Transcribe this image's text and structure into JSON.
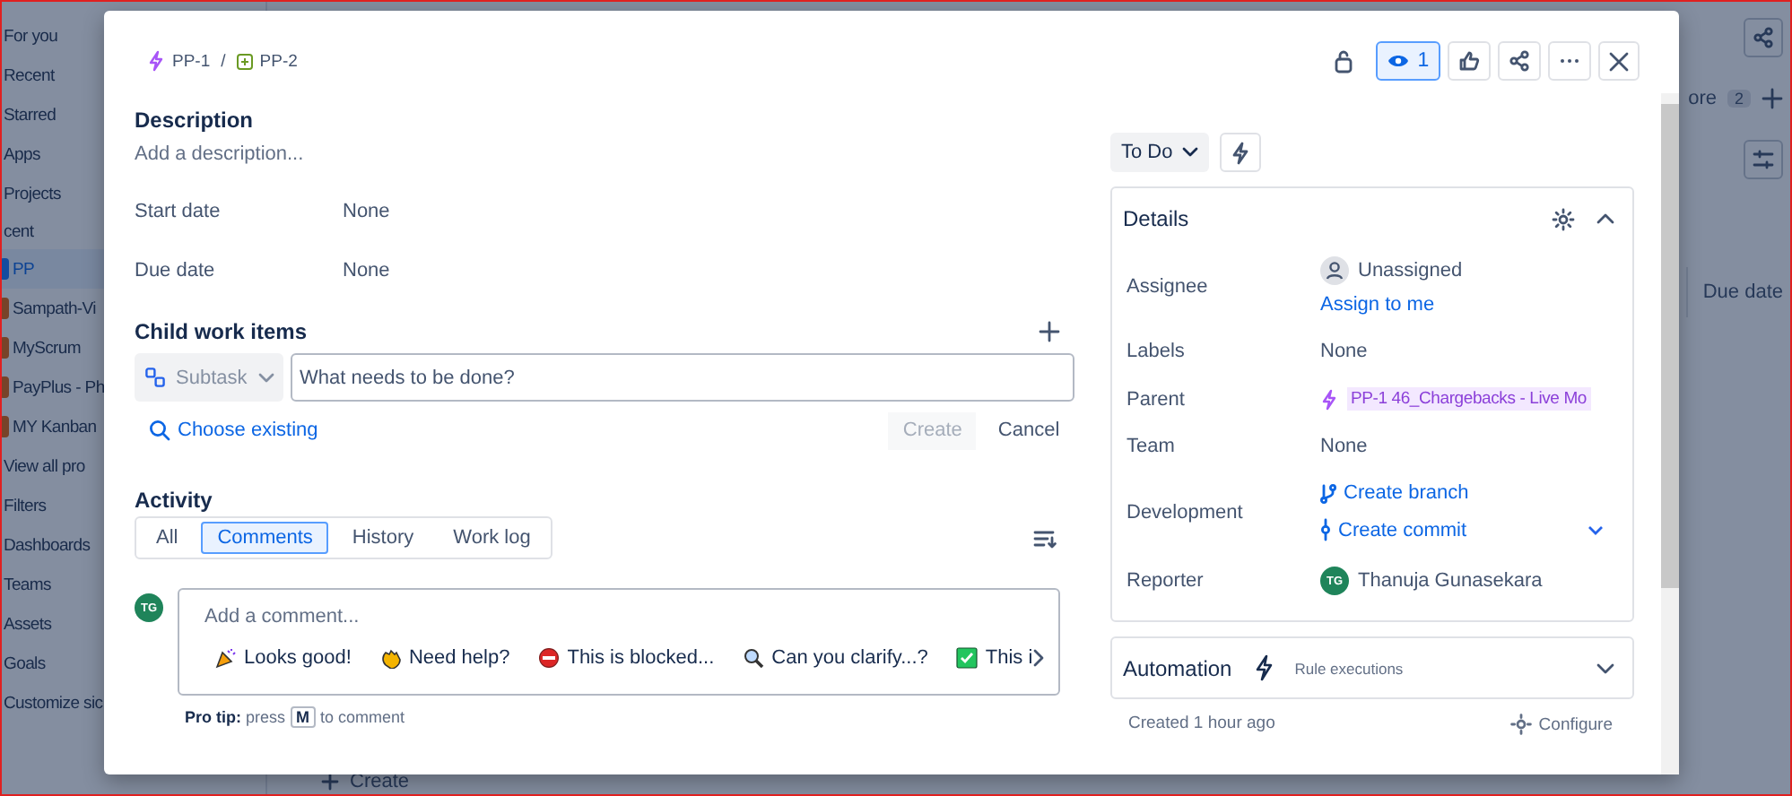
{
  "background": {
    "sidebar": [
      {
        "label": "For you",
        "kind": "link",
        "selected": false
      },
      {
        "label": "Recent",
        "kind": "link",
        "selected": false
      },
      {
        "label": "Starred",
        "kind": "link",
        "selected": false
      },
      {
        "label": "Apps",
        "kind": "link",
        "selected": false
      },
      {
        "label": "Projects",
        "kind": "link",
        "selected": false
      },
      {
        "label": "cent",
        "kind": "section",
        "selected": false
      },
      {
        "label": "PP",
        "kind": "project",
        "selected": true
      },
      {
        "label": "Sampath-Vi",
        "kind": "project",
        "selected": false
      },
      {
        "label": "MyScrum",
        "kind": "project",
        "selected": false
      },
      {
        "label": "PayPlus - Ph",
        "kind": "project",
        "selected": false
      },
      {
        "label": "MY Kanban",
        "kind": "project",
        "selected": false
      },
      {
        "label": "View all pro",
        "kind": "link",
        "selected": false
      },
      {
        "label": "Filters",
        "kind": "link",
        "selected": false
      },
      {
        "label": "Dashboards",
        "kind": "link",
        "selected": false
      },
      {
        "label": "Teams",
        "kind": "link",
        "selected": false
      },
      {
        "label": "Assets",
        "kind": "link",
        "selected": false
      },
      {
        "label": "Goals",
        "kind": "link",
        "selected": false
      },
      {
        "label": "Customize sic",
        "kind": "link",
        "selected": false
      }
    ],
    "more_label": "ore",
    "more_count": "2",
    "column_header": "Due date",
    "create_label": "Create"
  },
  "modal": {
    "breadcrumb_separator": "/",
    "breadcrumb": [
      {
        "key": "PP-1",
        "kind": "epic"
      },
      {
        "key": "PP-2",
        "kind": "subtask"
      }
    ],
    "watchers": {
      "count": "1",
      "selected": true
    },
    "description": {
      "title": "Description",
      "placeholder": "Add a description..."
    },
    "dates": [
      {
        "label": "Start date",
        "value": "None"
      },
      {
        "label": "Due date",
        "value": "None"
      }
    ],
    "child_items": {
      "title": "Child work items",
      "type_select": "Subtask",
      "placeholder": "What needs to be done?",
      "choose_existing": "Choose existing",
      "create": "Create",
      "cancel": "Cancel"
    },
    "activity": {
      "title": "Activity",
      "tabs": [
        {
          "label": "All",
          "selected": false
        },
        {
          "label": "Comments",
          "selected": true
        },
        {
          "label": "History",
          "selected": false
        },
        {
          "label": "Work log",
          "selected": false
        }
      ],
      "avatar": "TG",
      "comment_placeholder": "Add a comment...",
      "quick_replies": [
        {
          "label": "Looks good!",
          "kind": "party"
        },
        {
          "label": "Need help?",
          "kind": "wave"
        },
        {
          "label": "This is blocked...",
          "kind": "blocked"
        },
        {
          "label": "Can you clarify...?",
          "kind": "search"
        },
        {
          "label": "This i",
          "kind": "check"
        }
      ],
      "pro_tip": "**Pro tip:** press",
      "key": "M",
      "pro_tip_end": "to comment"
    },
    "status": "To Do",
    "details": {
      "title": "Details",
      "expanded": true,
      "assignee": {
        "label": "Assignee",
        "value": "Unassigned",
        "link": "Assign to me"
      },
      "labels": {
        "label": "Labels",
        "value": "None"
      },
      "parent": {
        "label": "Parent",
        "value": "PP-1 46_Chargebacks - Live Mo"
      },
      "team": {
        "label": "Team",
        "value": "None"
      },
      "development": {
        "label": "Development",
        "links": [
          "Create branch",
          "Create commit"
        ]
      },
      "reporter": {
        "label": "Reporter",
        "avatar": "TG",
        "name": "Thanuja Gunasekara"
      }
    },
    "automation": {
      "title": "Automation",
      "subtitle": "Rule executions",
      "expanded": false
    },
    "created": "Created 1 hour ago",
    "configure": "Configure"
  }
}
